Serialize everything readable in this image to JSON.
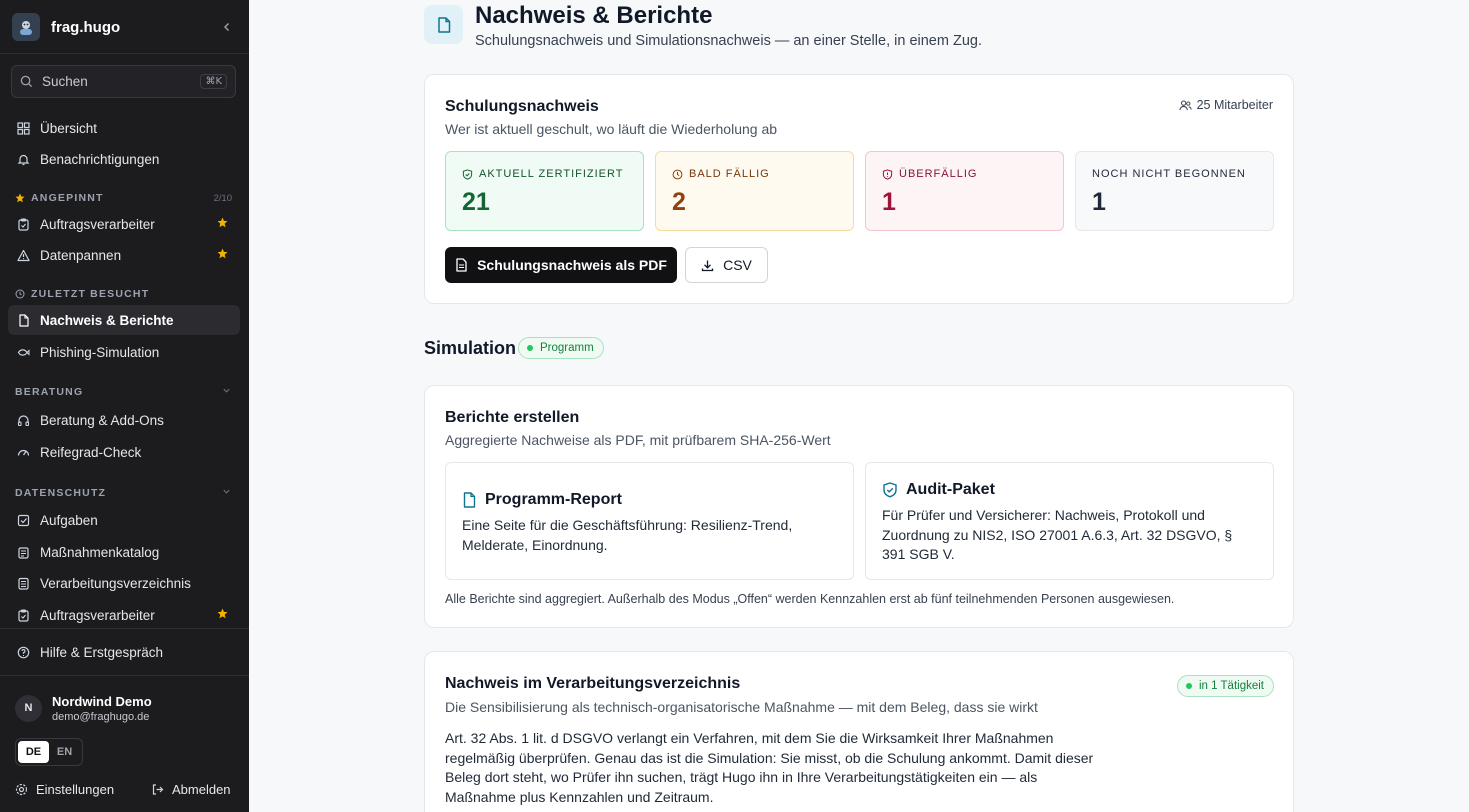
{
  "sidebar": {
    "brand": "frag.hugo",
    "search": {
      "placeholder": "Suchen",
      "shortcut": "⌘K"
    },
    "top_items": [
      {
        "label": "Übersicht",
        "icon": "grid-icon"
      },
      {
        "label": "Benachrichtigungen",
        "icon": "bell-icon"
      }
    ],
    "pinned": {
      "title": "ANGEPINNT",
      "count": "2/10",
      "items": [
        {
          "label": "Auftragsverarbeiter",
          "icon": "clipboard-icon"
        },
        {
          "label": "Datenpannen",
          "icon": "warning-icon"
        }
      ]
    },
    "recent": {
      "title": "ZULETZT BESUCHT",
      "items": [
        {
          "label": "Nachweis & Berichte",
          "icon": "file-icon"
        },
        {
          "label": "Phishing-Simulation",
          "icon": "fish-icon"
        }
      ]
    },
    "beratung": {
      "title": "BERATUNG",
      "items": [
        {
          "label": "Beratung & Add-Ons",
          "icon": "headphones-icon"
        },
        {
          "label": "Reifegrad-Check",
          "icon": "gauge-icon"
        }
      ]
    },
    "datenschutz": {
      "title": "DATENSCHUTZ",
      "items": [
        {
          "label": "Aufgaben",
          "icon": "checklist-icon"
        },
        {
          "label": "Maßnahmenkatalog",
          "icon": "catalog-icon"
        },
        {
          "label": "Verarbeitungsverzeichnis",
          "icon": "list-icon"
        },
        {
          "label": "Auftragsverarbeiter",
          "icon": "clipboard-icon"
        }
      ]
    },
    "help": "Hilfe & Erstgespräch",
    "user": {
      "initial": "N",
      "name": "Nordwind Demo",
      "email": "demo@fraghugo.de"
    },
    "lang": {
      "de": "DE",
      "en": "EN",
      "active": "DE"
    },
    "settings": "Einstellungen",
    "logout": "Abmelden"
  },
  "page": {
    "title": "Nachweis & Berichte",
    "subtitle": "Schulungsnachweis und Simulationsnachweis — an einer Stelle, in einem Zug."
  },
  "schulung": {
    "title": "Schulungsnachweis",
    "subtitle": "Wer ist aktuell geschult, wo läuft die Wiederholung ab",
    "employees": "25 Mitarbeiter",
    "stats": [
      {
        "label": "AKTUELL ZERTIFIZIERT",
        "value": "21",
        "color": "#166534"
      },
      {
        "label": "BALD FÄLLIG",
        "value": "2",
        "color": "#92400e"
      },
      {
        "label": "ÜBERFÄLLIG",
        "value": "1",
        "color": "#9f1239"
      },
      {
        "label": "NOCH NICHT BEGONNEN",
        "value": "1",
        "color": "#1f2937"
      }
    ],
    "pdf_button": "Schulungsnachweis als PDF",
    "csv_button": "CSV"
  },
  "simulation": {
    "title": "Simulation",
    "badge": "Programm"
  },
  "berichte": {
    "title": "Berichte erstellen",
    "subtitle": "Aggregierte Nachweise als PDF, mit prüfbarem SHA-256-Wert",
    "reports": [
      {
        "title": "Programm-Report",
        "text": "Eine Seite für die Geschäftsführung: Resilienz-Trend, Melderate, Einordnung."
      },
      {
        "title": "Audit-Paket",
        "text": "Für Prüfer und Versicherer: Nachweis, Protokoll und Zuordnung zu NIS2, ISO 27001 A.6.3, Art. 32 DSGVO, § 391 SGB V."
      }
    ],
    "note": "Alle Berichte sind aggregiert. Außerhalb des Modus „Offen“ werden Kennzahlen erst ab fünf teilnehmenden Personen ausgewiesen."
  },
  "nachweis": {
    "title": "Nachweis im Verarbeitungsverzeichnis",
    "subtitle": "Die Sensibilisierung als technisch-organisatorische Maßnahme — mit dem Beleg, dass sie wirkt",
    "badge": "in 1 Tätigkeit",
    "text": "Art. 32 Abs. 1 lit. d DSGVO verlangt ein Verfahren, mit dem Sie die Wirksamkeit Ihrer Maßnahmen regelmäßig überprüfen. Genau das ist die Simulation: Sie misst, ob die Schulung ankommt. Damit dieser Beleg dort steht, wo Prüfer ihn suchen, trägt Hugo ihn in Ihre Verarbeitungstätigkeiten ein — als Maßnahme plus Kennzahlen und Zeitraum."
  }
}
